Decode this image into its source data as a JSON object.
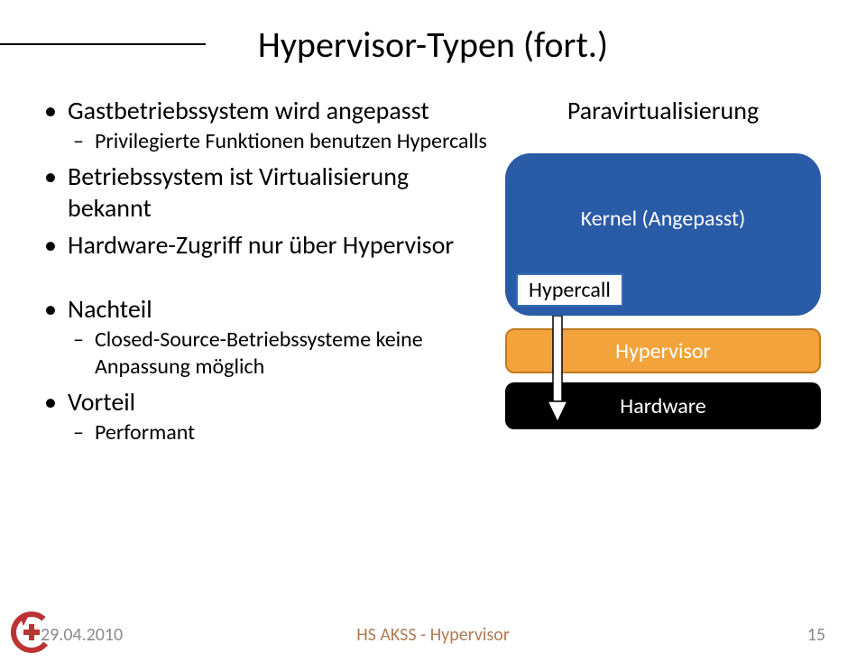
{
  "title": "Hypervisor-Typen (fort.)",
  "bullets": {
    "b1": "Gastbetriebssystem wird angepasst",
    "b1_1": "Privilegierte Funktionen benutzen Hypercalls",
    "b2": "Betriebssystem ist Virtualisierung bekannt",
    "b3": "Hardware-Zugriff nur über Hypervisor",
    "b4": "Nachteil",
    "b4_1": "Closed-Source-Betriebssysteme keine Anpassung möglich",
    "b5": "Vorteil",
    "b5_1": "Performant"
  },
  "diagram": {
    "title": "Paravirtualisierung",
    "kernel": "Kernel (Angepasst)",
    "hypercall": "Hypercall",
    "hypervisor": "Hypervisor",
    "hardware": "Hardware"
  },
  "footer": {
    "date": "29.04.2010",
    "center": "HS AKSS - Hypervisor",
    "page": "15"
  }
}
